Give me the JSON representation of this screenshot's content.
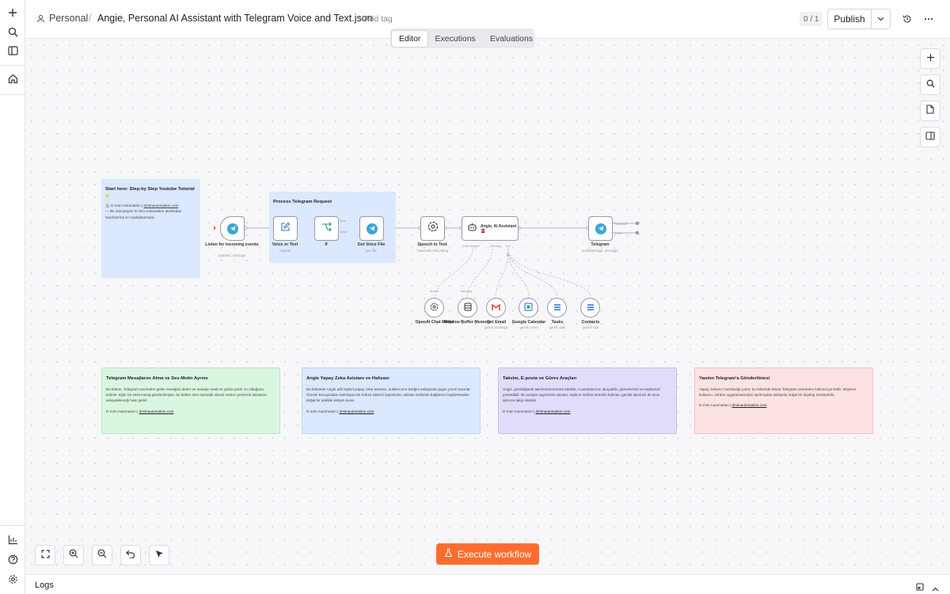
{
  "header": {
    "project": "Personal",
    "separator": "/",
    "workflow_name": "Angie, Personal AI Assistant with Telegram Voice and Text.json",
    "add_tag": "+ Add tag",
    "tabs": [
      "Editor",
      "Executions",
      "Evaluations"
    ],
    "active_tab": "Editor",
    "version_counter": "0 / 1",
    "publish_label": "Publish"
  },
  "stickies": {
    "start": {
      "title": "Start here: Step-by Step Youtube Tutorial",
      "emoji": "👇",
      "line1_prefix": "🏢 D-mim Automation | ",
      "line1_link": "dmimautomation.com",
      "body": "— Bu otomasyon D-mim Automation tarafından hazırlanmış ve markalanmıştır."
    },
    "process": {
      "title": "Process Telegram Request"
    },
    "green": {
      "title": "Telegram Mesajlarını Alma ve Ses-Metin Ayrımı",
      "body": "Bu bölüm, Telegram üzerinden gelen mesajları dinler ve mesajın sesli mi yoksa yazılı mı olduğunu belirler. Eğer bir sesli mesaj gönderilmişse, bu bölüm sesi otomatik olarak metne çevirerek asistanın anlayabileceği hale getirir.",
      "foot_prefix": "D-mim Automation | ",
      "foot_link": "dmimautomation.com"
    },
    "blue": {
      "title": "Angie Yapay Zeka Asistanı ve Hafızası",
      "body": "Bu bölümde Angie adlı kişisel yapay zeka asistanı, kullanıcının isteğini anlayarak uygun yanıtı hazırlar. Önceki konuşmaları hatırlayan bir hafıza sistemi sayesinde, asistan sohbetin bağlamını kaybetmeden doğal bir şekilde iletişim kurar.",
      "foot_prefix": "D-mim Automation | ",
      "foot_link": "dmimautomation.com"
    },
    "purple": {
      "title": "Takvim, E-posta ve Görev Araçları",
      "body": "Angie, gerektiğinde takviminizi kontrol edebilir, e-postalarınızı okuyabilir, görevlerinizi ve kişilerinizi yönetebilir. Bu araçlar sayesinde asistan, sadece sohbet etmekle kalmaz, günlük işlerinizi de sizin adınıza takip edebilir.",
      "foot_prefix": "D-mim Automation | ",
      "foot_link": "dmimautomation.com"
    },
    "red": {
      "title": "Yanıtın Telegram'a Gönderilmesi",
      "body": "Yapay zekanın hazırladığı yanıt, bu bölümde tekrar Telegram üzerinden kullanıcıya iletilir. Böylece kullanıcı, sohbet uygulamasından ayrılmadan asistanla doğal bir diyalog sürdürebilir.",
      "foot_prefix": "D-mim Automation | ",
      "foot_link": "dmimautomation.com"
    }
  },
  "nodes": {
    "listen": {
      "label": "Listen for incoming events",
      "sub": "Updates: message",
      "icon": "telegram-icon"
    },
    "voice_or_text": {
      "label": "Voice or Text",
      "sub": "manual",
      "icon": "edit-icon"
    },
    "if": {
      "label": "If",
      "icon": "branch-icon",
      "out_true": "true",
      "out_false": "false"
    },
    "get_voice": {
      "label": "Get Voice File",
      "sub": "get: file",
      "icon": "telegram-icon"
    },
    "speech": {
      "label": "Speech to Text",
      "sub": "Transcribe Recording",
      "icon": "openai-icon"
    },
    "agent": {
      "label": "Angie, AI Assistant",
      "emoji": "🧕",
      "icon": "robot-icon",
      "ports": [
        "Chat Model*",
        "Memory",
        "Tool"
      ]
    },
    "telegram": {
      "label": "Telegram",
      "sub": "sendMessage: message",
      "icon": "telegram-icon",
      "out1": "Success",
      "out2": "Error"
    },
    "openai_model": {
      "label": "OpenAI Chat Model",
      "port": "Model",
      "icon": "openai-icon"
    },
    "memory": {
      "label": "Window Buffer Memory",
      "port": "Memory",
      "icon": "database-icon"
    },
    "get_email": {
      "label": "Get Email",
      "sub": "getAll: message",
      "icon": "gmail-icon"
    },
    "calendar": {
      "label": "Google Calendar",
      "sub": "getAll: event",
      "icon": "calendar-icon"
    },
    "tasks": {
      "label": "Tasks",
      "sub": "getAll: task",
      "icon": "tasks-icon"
    },
    "contacts": {
      "label": "Contacts",
      "sub": "getAll: row",
      "icon": "contacts-icon"
    }
  },
  "footer": {
    "execute_label": "Execute workflow",
    "logs_label": "Logs"
  },
  "colors": {
    "accent": "#ff6d2e",
    "sticky_start": "#dbe8fd",
    "sticky_green": "#d9f7e0",
    "sticky_blue": "#dbe8fd",
    "sticky_purple": "#e2dcfb",
    "sticky_red": "#fde2e2",
    "telegram": "#3ba6d9"
  }
}
